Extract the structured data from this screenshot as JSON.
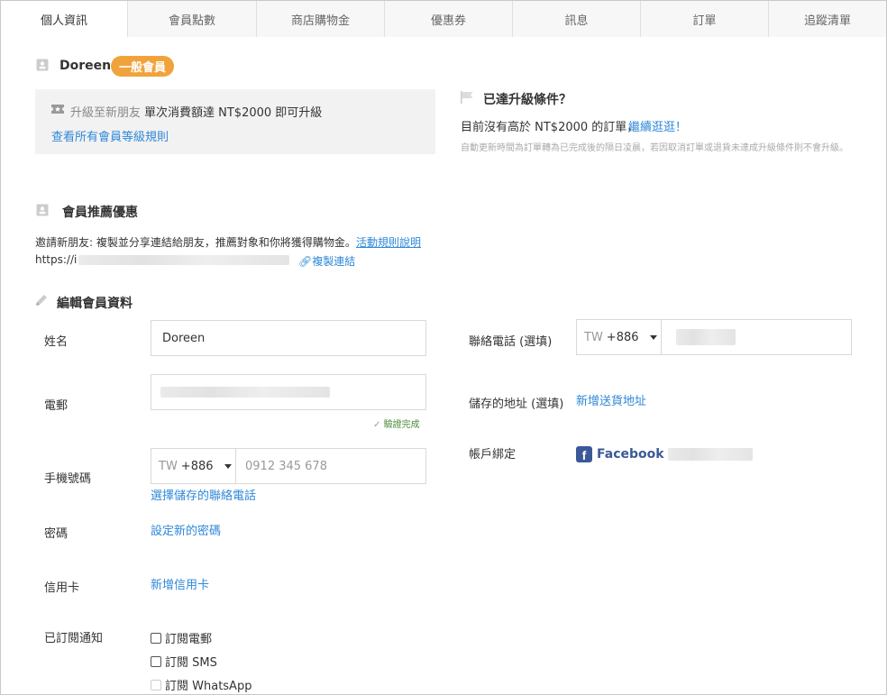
{
  "tabs": [
    {
      "label": "個人資訊",
      "active": true
    },
    {
      "label": "會員點數",
      "active": false
    },
    {
      "label": "商店購物金",
      "active": false
    },
    {
      "label": "優惠券",
      "active": false
    },
    {
      "label": "訊息",
      "active": false
    },
    {
      "label": "訂單",
      "active": false
    },
    {
      "label": "追蹤清單",
      "active": false
    }
  ],
  "member": {
    "name": "Doreen",
    "tier": "一般會員",
    "tier_color": "#f1a33b"
  },
  "upgrade": {
    "prefix": "升級至新朋友",
    "condition": "單次消費額達 NT$2000 即可升級",
    "rules_link": "查看所有會員等級規則"
  },
  "upgrade_status": {
    "title": "已達升級條件？",
    "message": "目前沒有高於 NT$2000 的訂單，",
    "cta": "繼續逛逛！",
    "note": "自動更新時間為訂單轉為已完成後的隔日凌晨，若因取消訂單或退貨未達成升級條件則不會升級。"
  },
  "referral": {
    "title": "會員推薦優惠",
    "text": "邀請新朋友: 複製並分享連結給朋友，推薦對象和你將獲得購物金。",
    "rules_link": "活動規則說明",
    "url_prefix": "https://i",
    "copy_link": "複製連結"
  },
  "edit": {
    "title": "編輯會員資料",
    "name_label": "姓名",
    "name_value": "Doreen",
    "email_label": "電郵",
    "email_verified": "驗證完成",
    "mobile_label": "手機號碼",
    "mobile_country": "TW",
    "mobile_code": "+886",
    "mobile_placeholder": "0912 345 678",
    "mobile_link": "選擇儲存的聯絡電話",
    "password_label": "密碼",
    "password_link": "設定新的密碼",
    "card_label": "信用卡",
    "card_link": "新增信用卡",
    "subscribe_label": "已訂閱通知",
    "subscriptions": [
      "訂閱電郵",
      "訂閱 SMS",
      "訂閱 WhatsApp"
    ],
    "phone_label": "聯絡電話 (選填)",
    "phone_country": "TW",
    "phone_code": "+886",
    "address_label": "儲存的地址 (選填)",
    "address_link": "新增送貨地址",
    "binding_label": "帳戶綁定",
    "facebook_label": "Facebook"
  },
  "colors": {
    "link": "#2f88d8",
    "badge": "#f1a33b",
    "verified": "#4a8a3a",
    "facebook": "#3b5998"
  }
}
